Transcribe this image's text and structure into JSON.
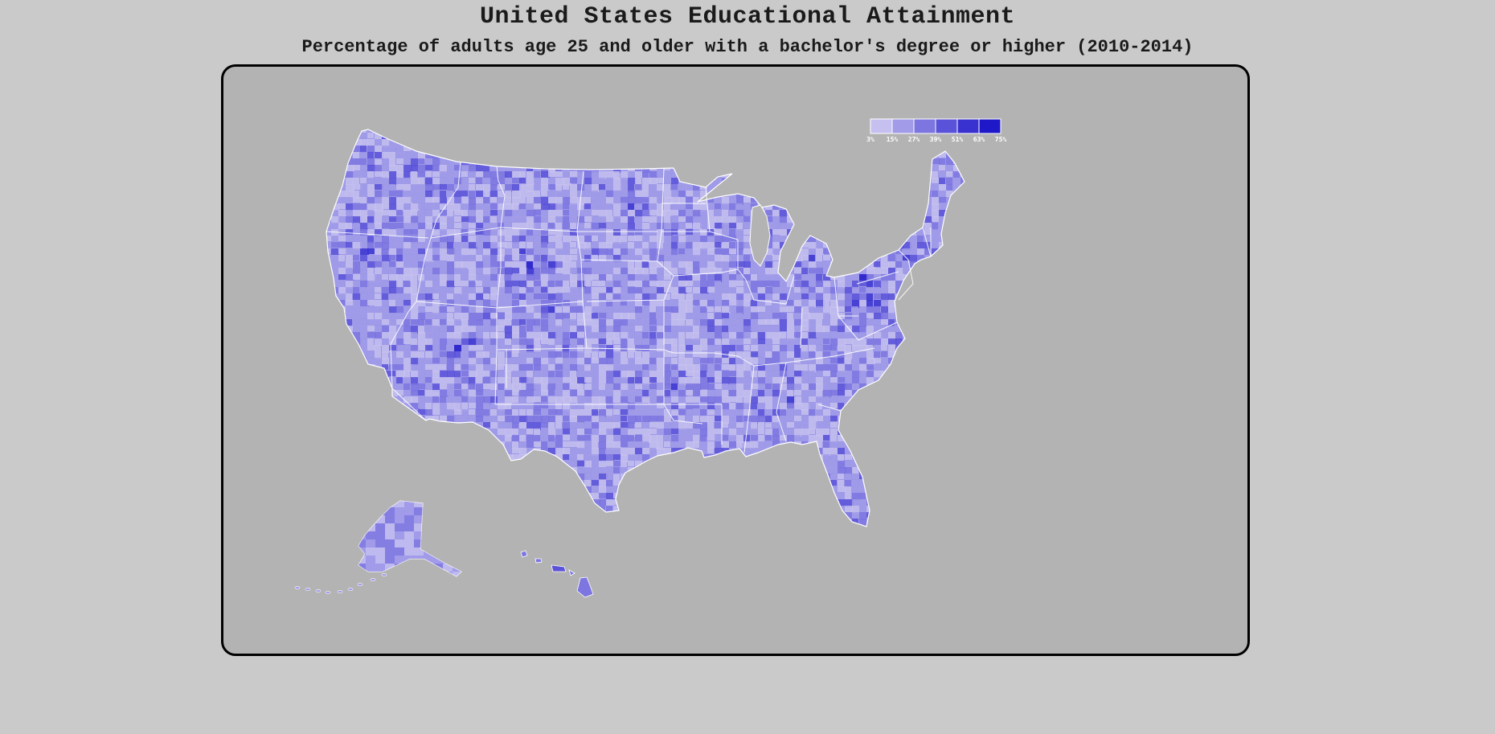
{
  "title": "United States Educational Attainment",
  "subtitle": "Percentage of adults age 25 and older with a bachelor's degree or higher (2010-2014)",
  "legend": {
    "labels": [
      "3%",
      "15%",
      "27%",
      "39%",
      "51%",
      "63%",
      "75%"
    ],
    "colors": [
      "#c5c0ef",
      "#a19be8",
      "#7d76e0",
      "#5a52d8",
      "#3a32d0",
      "#1f18c9",
      "#0808c2"
    ]
  },
  "map": {
    "background": "#b3b3b3",
    "border_color": "#ffffff"
  }
}
